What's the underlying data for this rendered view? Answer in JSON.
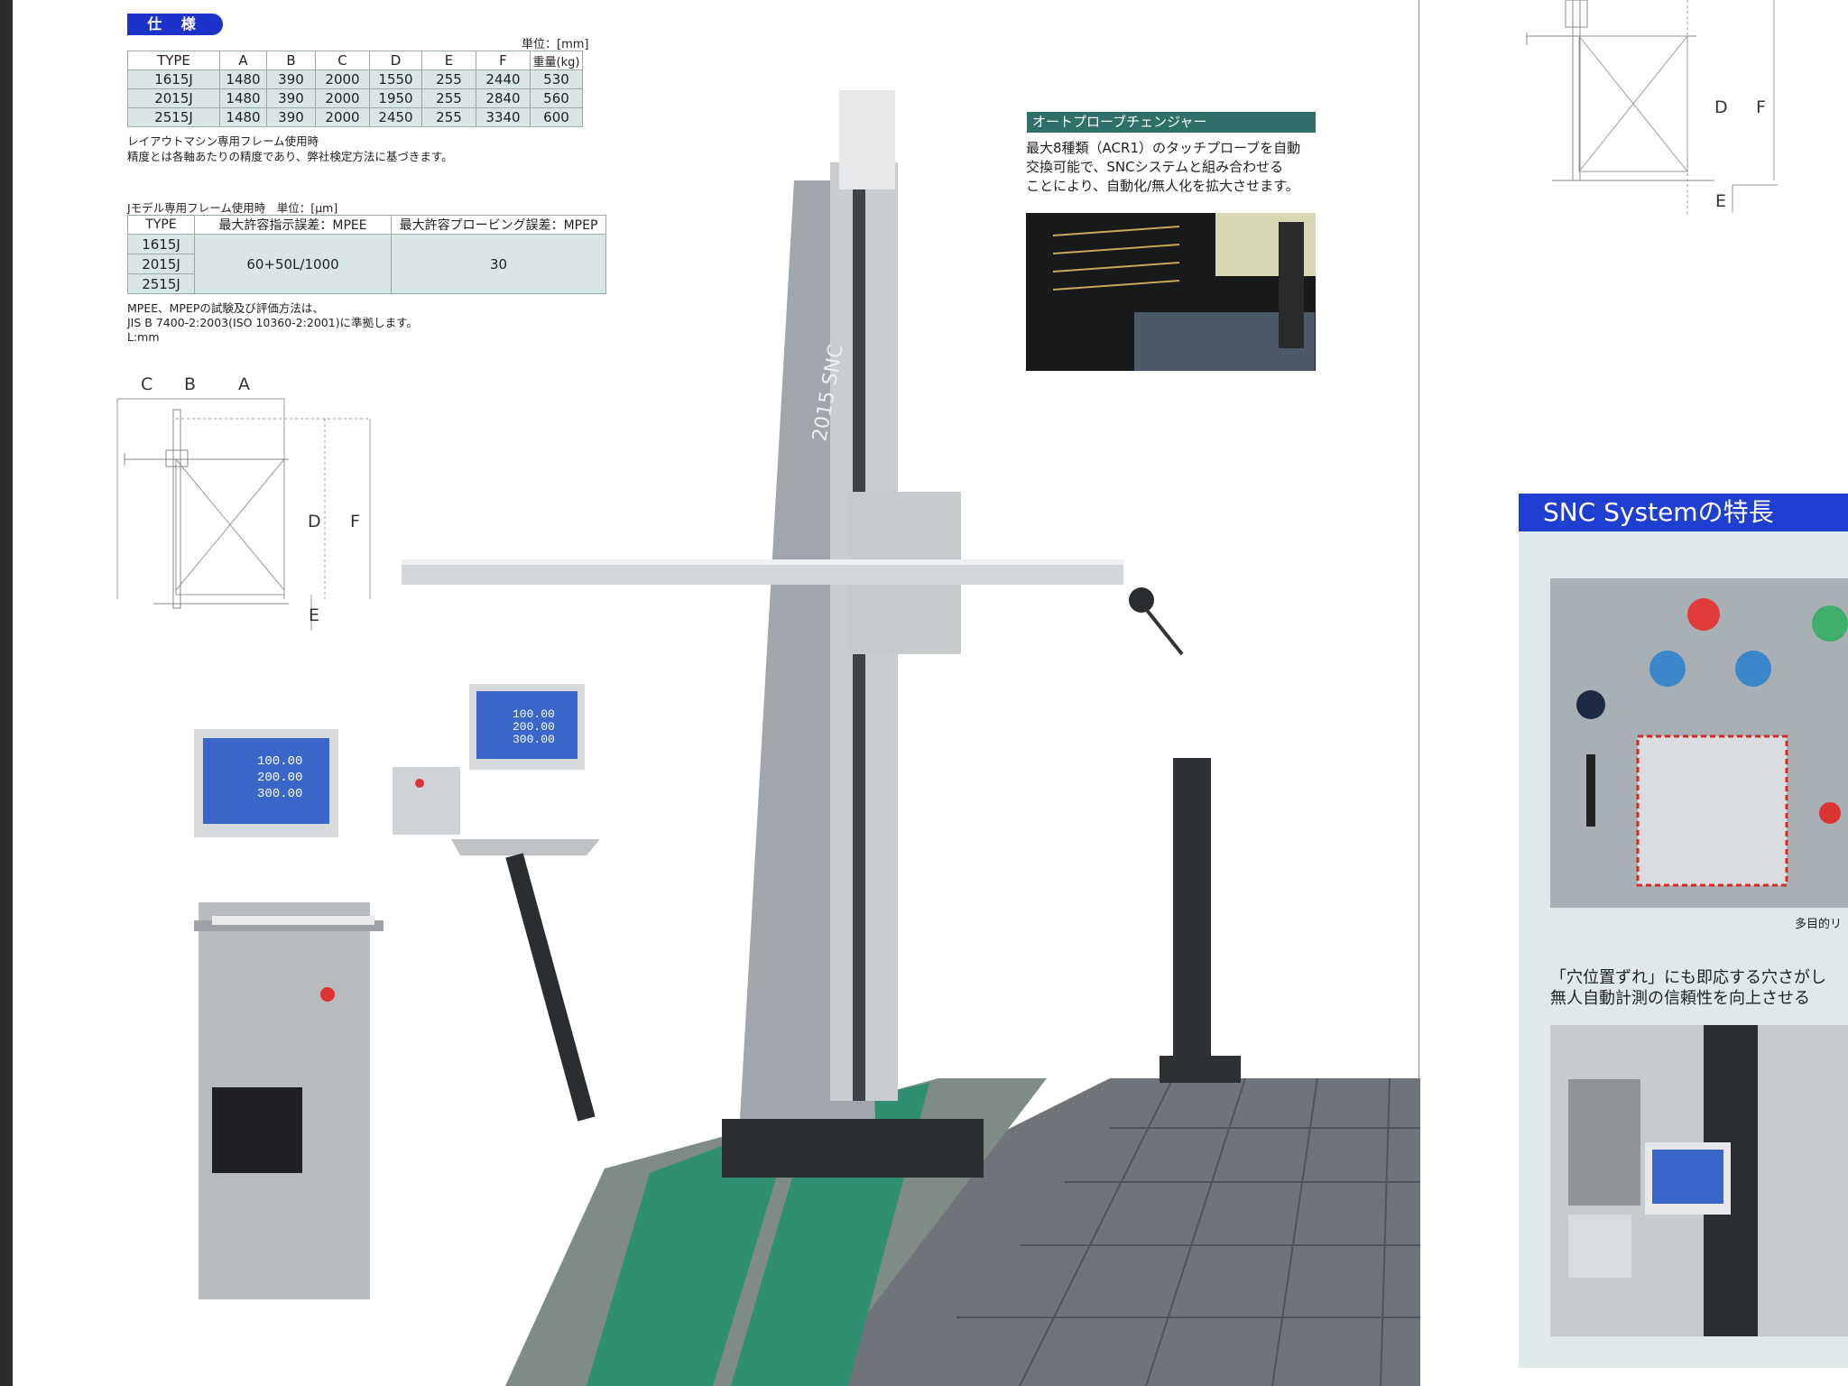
{
  "spec": {
    "badge": "仕 様",
    "unit": "単位：[mm]",
    "headers": [
      "TYPE",
      "A",
      "B",
      "C",
      "D",
      "E",
      "F",
      "重量(kg)"
    ],
    "rows": [
      [
        "1615J",
        "1480",
        "390",
        "2000",
        "1550",
        "255",
        "2440",
        "530"
      ],
      [
        "2015J",
        "1480",
        "390",
        "2000",
        "1950",
        "255",
        "2840",
        "560"
      ],
      [
        "2515J",
        "1480",
        "390",
        "2000",
        "2450",
        "255",
        "3340",
        "600"
      ]
    ],
    "note_line1": "レイアウトマシン専用フレーム使用時",
    "note_line2": "精度とは各軸あたりの精度であり、弊社検定方法に基づきます。"
  },
  "jmodel": {
    "caption": "Jモデル専用フレーム使用時　単位：[μm]",
    "headers": [
      "TYPE",
      "最大許容指示誤差：MPEE",
      "最大許容プロービング誤差：MPEP"
    ],
    "types": [
      "1615J",
      "2015J",
      "2515J"
    ],
    "mpe_e": "60+50L/1000",
    "mpe_p": "30",
    "note_line1": "MPEE、MPEPの試験及び評価方法は、",
    "note_line2": "JIS B 7400-2:2003(ISO 10360-2:2001)に準拠します。",
    "note_line3": "L:mm"
  },
  "dimension_labels": {
    "c": "C",
    "b": "B",
    "a": "A",
    "d": "D",
    "f": "F",
    "e": "E"
  },
  "probe_changer": {
    "title": "オートプローブチェンジャー",
    "line1": "最大8種類（ACR1）のタッチプローブを自動",
    "line2": "交換可能で、SNCシステムと組み合わせる",
    "line3": "ことにより、自動化/無人化を拡大させます。"
  },
  "machine": {
    "column_label": "2015 SNC"
  },
  "monitor_readout": {
    "x": "100.00",
    "y": "200.00",
    "z": "300.00"
  },
  "snc": {
    "title": "SNC Systemの特長",
    "panel_caption": "多目的リ",
    "desc_line1": "「穴位置ずれ」にも即応する穴さがし",
    "desc_line2": "無人自動計測の信頼性を向上させる"
  },
  "colors": {
    "accent_blue": "#1c33c9",
    "teal": "#2f6f6a",
    "table_fill": "#d8e6e6",
    "panel_fill": "#dfe9e9"
  }
}
